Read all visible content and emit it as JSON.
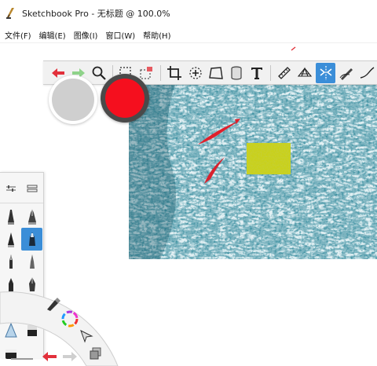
{
  "window": {
    "title": "Sketchbook Pro - 无标题 @ 100.0%"
  },
  "menu": [
    "文件(F)",
    "编辑(E)",
    "图像(I)",
    "窗口(W)",
    "帮助(H)"
  ],
  "toolbar": {
    "buttons": [
      "undo-icon",
      "redo-icon",
      "zoom-icon",
      "select-icon",
      "transform-select-icon",
      "crop-icon",
      "lasso-icon",
      "perspective-icon",
      "cylinder-icon",
      "text-icon",
      "ruler-icon",
      "perspective-grid-icon",
      "symmetry-icon",
      "ellipse-guide-icon",
      "curve-icon"
    ],
    "active": "symmetry-icon"
  },
  "colors": {
    "secondary": "#cfcfcf",
    "primary": "#f50f1e",
    "accent": "#3b8ed8"
  },
  "palette": {
    "active": "brush-marker"
  }
}
